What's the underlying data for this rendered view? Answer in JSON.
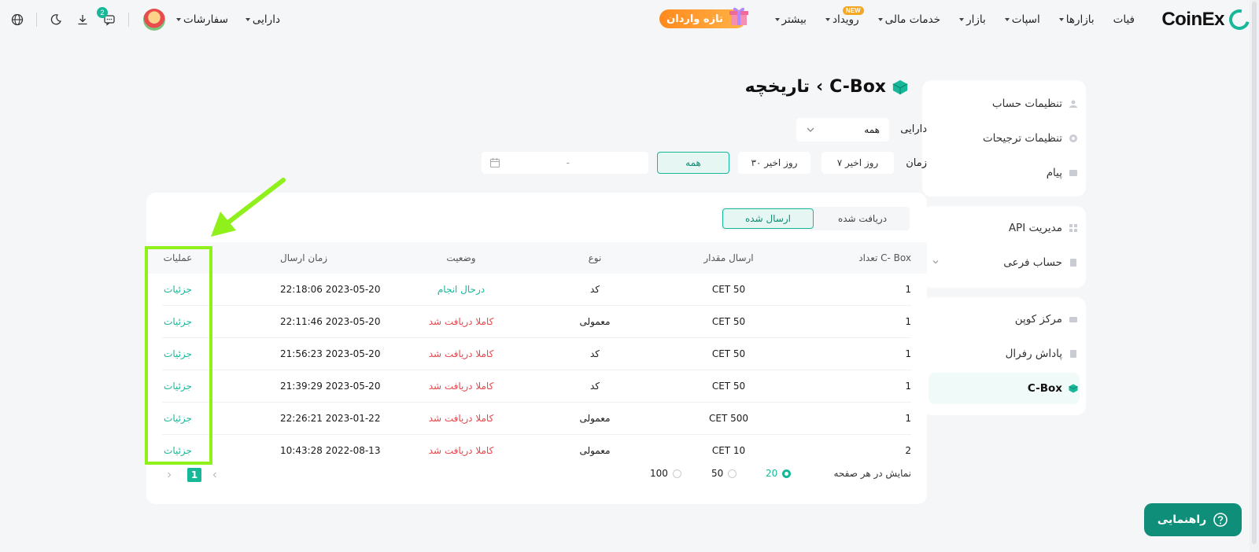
{
  "header": {
    "logo_text": "CoinEx",
    "nav": [
      {
        "label": "فیات",
        "caret": false
      },
      {
        "label": "بازارها",
        "caret": true
      },
      {
        "label": "اسپات",
        "caret": true
      },
      {
        "label": "بازار",
        "caret": true
      },
      {
        "label": "خدمات مالی",
        "caret": true
      },
      {
        "label": "رویداد",
        "caret": true,
        "badge": "NEW"
      },
      {
        "label": "بیشتر",
        "caret": true
      }
    ],
    "promo_label": "تازه واردان",
    "assets_label": "دارایی",
    "orders_label": "سفارشات",
    "message_count": "2",
    "icons": [
      "language-icon",
      "moon-icon",
      "download-icon",
      "message-icon"
    ]
  },
  "sidebar": {
    "group1": [
      "تنظیمات حساب",
      "تنظیمات ترجیحات",
      "پیام"
    ],
    "group2": [
      "مدیریت API",
      "حساب فرعی"
    ],
    "group3": [
      "مرکز کوپن",
      "پاداش رفرال",
      "C-Box"
    ]
  },
  "page": {
    "title_prefix": "C-Box",
    "title_sep": "›",
    "title": "تاریخچه",
    "asset_label": "دارایی",
    "asset_value": "همه",
    "time_label": "زمان",
    "time_buttons": [
      "۷ روز اخیر",
      "۳۰ روز اخیر",
      "همه"
    ],
    "date_placeholder": "-"
  },
  "table": {
    "tabs": [
      "دریافت شده",
      "ارسال شده"
    ],
    "headers": {
      "count": "تعداد C- Box",
      "amount": "ارسال مقدار",
      "type": "نوع",
      "status": "وضعیت",
      "time": "زمان ارسال",
      "ops": "عملیات"
    },
    "rows": [
      {
        "count": "1",
        "amount": "CET 50",
        "type": "کد",
        "status": "درحال انجام",
        "time": "22:18:06 2023-05-20",
        "op": "جزئیات"
      },
      {
        "count": "1",
        "amount": "CET 50",
        "type": "معمولی",
        "status": "کاملا دریافت شد",
        "time": "22:11:46 2023-05-20",
        "op": "جزئیات"
      },
      {
        "count": "1",
        "amount": "CET 50",
        "type": "کد",
        "status": "کاملا دریافت شد",
        "time": "21:56:23 2023-05-20",
        "op": "جزئیات"
      },
      {
        "count": "1",
        "amount": "CET 50",
        "type": "کد",
        "status": "کاملا دریافت شد",
        "time": "21:39:29 2023-05-20",
        "op": "جزئیات"
      },
      {
        "count": "1",
        "amount": "CET 500",
        "type": "معمولی",
        "status": "کاملا دریافت شد",
        "time": "22:26:21 2023-01-22",
        "op": "جزئیات"
      },
      {
        "count": "2",
        "amount": "CET 10",
        "type": "معمولی",
        "status": "کاملا دریافت شد",
        "time": "10:43:28 2022-08-13",
        "op": "جزئیات"
      }
    ],
    "per_page_label": "نمایش در هر صفحه",
    "per_page_options": [
      "20",
      "50",
      "100"
    ],
    "current_page": "1"
  },
  "help_label": "راهنمایی",
  "colors": {
    "accent": "#17b899",
    "danger": "#e5484d",
    "highlight": "#90f01c"
  }
}
